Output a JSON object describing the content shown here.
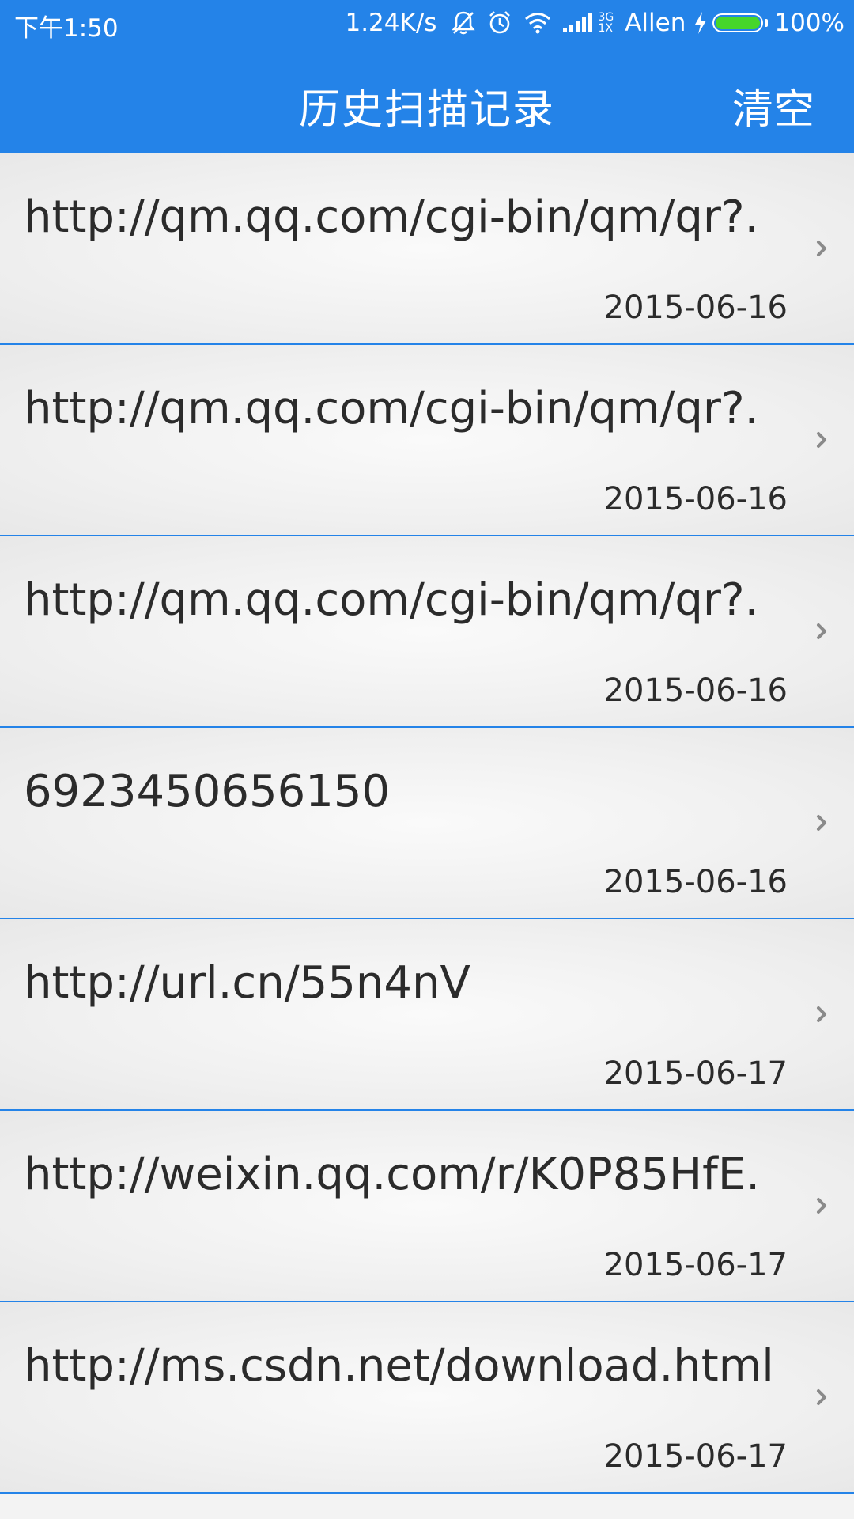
{
  "status_bar": {
    "time": "下午1:50",
    "speed": "1.24K/s",
    "network_type": "3G",
    "network_sub": "1X",
    "carrier": "Allen",
    "battery": "100%",
    "battery_level": 1.0,
    "icons": [
      "mute-icon",
      "alarm-icon",
      "wifi-icon",
      "signal-icon",
      "charging-icon",
      "battery-icon"
    ]
  },
  "header": {
    "title": "历史扫描记录",
    "clear_label": "清空"
  },
  "history": [
    {
      "content": "http://qm.qq.com/cgi-bin/qm/qr?.",
      "date": "2015-06-16"
    },
    {
      "content": "http://qm.qq.com/cgi-bin/qm/qr?.",
      "date": "2015-06-16"
    },
    {
      "content": "http://qm.qq.com/cgi-bin/qm/qr?.",
      "date": "2015-06-16"
    },
    {
      "content": "6923450656150",
      "date": "2015-06-16"
    },
    {
      "content": "http://url.cn/55n4nV",
      "date": "2015-06-17"
    },
    {
      "content": "http://weixin.qq.com/r/K0P85HfE.",
      "date": "2015-06-17"
    },
    {
      "content": "http://ms.csdn.net/download.html",
      "date": "2015-06-17"
    }
  ],
  "colors": {
    "primary": "#2483e8",
    "text": "#2b2b2b",
    "chevron": "#8a8a8a",
    "battery_fill": "#46d62a"
  }
}
